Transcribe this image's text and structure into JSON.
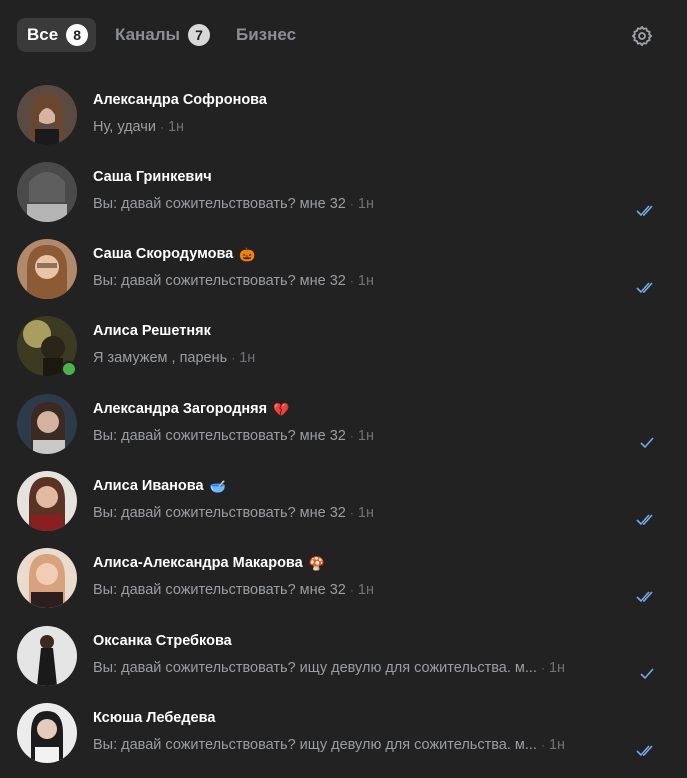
{
  "tabs": [
    {
      "label": "Все",
      "badge": "8"
    },
    {
      "label": "Каналы",
      "badge": "7"
    },
    {
      "label": "Бизнес"
    }
  ],
  "icons": {
    "settings": "gear-icon",
    "read": "double-check-icon",
    "delivered": "single-check-icon"
  },
  "colors": {
    "background": "#222222",
    "check": "#71aaeb",
    "online": "#4bb34b"
  },
  "chats": [
    {
      "name": "Александра Софронова",
      "emoji": "",
      "text": "Ну, удачи",
      "time": "1н",
      "status": "none"
    },
    {
      "name": "Саша Гринкевич",
      "emoji": "",
      "text": "Вы: давай сожительствовать? мне 32",
      "time": "1н",
      "status": "read"
    },
    {
      "name": "Саша Скородумова",
      "emoji": "🎃",
      "text": "Вы: давай сожительствовать? мне 32",
      "time": "1н",
      "status": "read"
    },
    {
      "name": "Алиса Решетняк",
      "emoji": "",
      "text": "Я замужем , парень",
      "time": "1н",
      "status": "none",
      "online": true
    },
    {
      "name": "Александра Загородняя",
      "emoji": "💔",
      "text": "Вы: давай сожительствовать? мне 32",
      "time": "1н",
      "status": "delivered"
    },
    {
      "name": "Алиса Иванова",
      "emoji": "🥣",
      "text": "Вы: давай сожительствовать? мне 32",
      "time": "1н",
      "status": "read"
    },
    {
      "name": "Алиса-Александра Макарова",
      "emoji": "🍄",
      "text": "Вы: давай сожительствовать? мне 32",
      "time": "1н",
      "status": "read"
    },
    {
      "name": "Оксанка Стребкова",
      "emoji": "",
      "text": "Вы: давай сожительствовать? ищу девулю для сожительства. м...",
      "time": "1н",
      "status": "delivered"
    },
    {
      "name": "Ксюша Лебедева",
      "emoji": "",
      "text": "Вы: давай сожительствовать? ищу девулю для сожительства. м...",
      "time": "1н",
      "status": "read"
    }
  ]
}
